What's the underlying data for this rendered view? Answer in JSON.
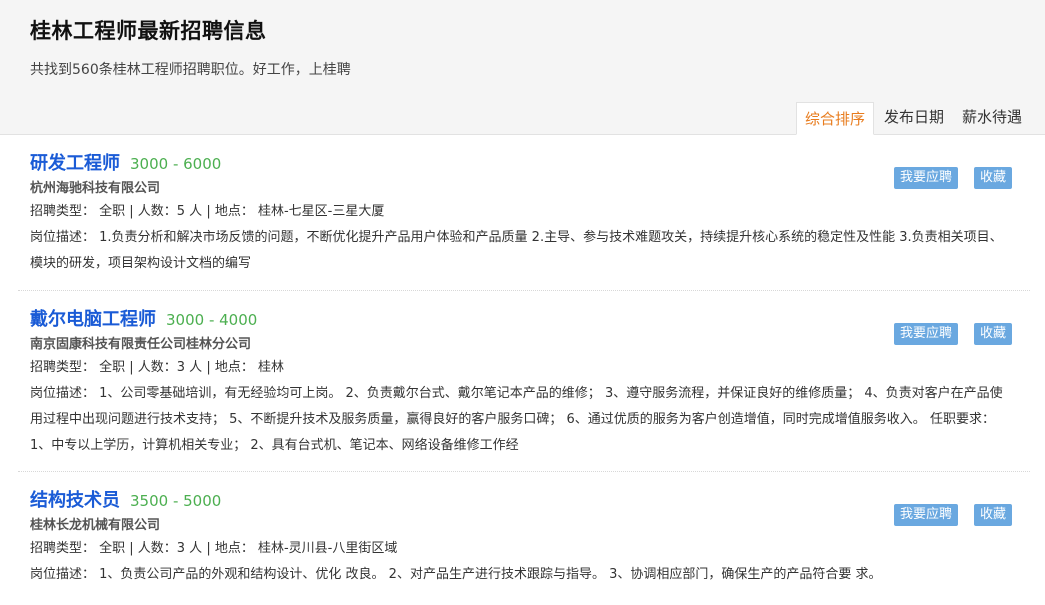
{
  "header": {
    "title": "桂林工程师最新招聘信息",
    "subtitle": "共找到560条桂林工程师招聘职位。好工作，上桂聘"
  },
  "sort_tabs": [
    {
      "label": "综合排序",
      "active": true
    },
    {
      "label": "发布日期",
      "active": false
    },
    {
      "label": "薪水待遇",
      "active": false
    }
  ],
  "jobs": [
    {
      "title": "研发工程师",
      "salary": "3000 - 6000",
      "company": "杭州海驰科技有限公司",
      "meta": "招聘类型： 全职 | 人数：5 人 | 地点： 桂林-七星区-三星大厦",
      "description": "岗位描述： 1.负责分析和解决市场反馈的问题，不断优化提升产品用户体验和产品质量 2.主导、参与技术难题攻关，持续提升核心系统的稳定性及性能 3.负责相关项目、模块的研发，项目架构设计文档的编写",
      "apply_label": "我要应聘",
      "favorite_label": "收藏"
    },
    {
      "title": "戴尔电脑工程师",
      "salary": "3000 - 4000",
      "company": "南京固康科技有限责任公司桂林分公司",
      "meta": "招聘类型： 全职 | 人数：3 人 | 地点： 桂林",
      "description": "岗位描述： 1、公司零基础培训，有无经验均可上岗。 2、负责戴尔台式、戴尔笔记本产品的维修； 3、遵守服务流程，并保证良好的维修质量； 4、负责对客户在产品使用过程中出现问题进行技术支持； 5、不断提升技术及服务质量，赢得良好的客户服务口碑； 6、通过优质的服务为客户创造增值，同时完成增值服务收入。 任职要求： 1、中专以上学历，计算机相关专业； 2、具有台式机、笔记本、网络设备维修工作经",
      "apply_label": "我要应聘",
      "favorite_label": "收藏"
    },
    {
      "title": "结构技术员",
      "salary": "3500 - 5000",
      "company": "桂林长龙机械有限公司",
      "meta": "招聘类型： 全职 | 人数：3 人 | 地点： 桂林-灵川县-八里街区域",
      "description": "岗位描述： 1、负责公司产品的外观和结构设计、优化 改良。 2、对产品生产进行技术跟踪与指导。 3、协调相应部门，确保生产的产品符合要 求。",
      "apply_label": "我要应聘",
      "favorite_label": "收藏"
    }
  ],
  "colors": {
    "title_blue": "#1a5bd6",
    "salary_green": "#4caf50",
    "active_tab_orange": "#e87c1e",
    "button_blue": "#6aa8e0",
    "header_bg": "#f5f5f5"
  }
}
